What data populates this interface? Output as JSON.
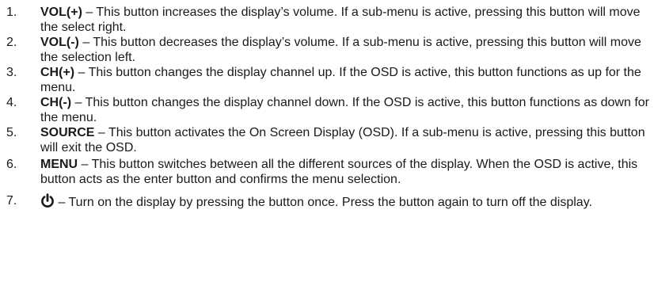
{
  "items": [
    {
      "number": "1.",
      "term": "VOL(+)",
      "text": " – This button increases the display’s volume.  If a sub-menu is active, pressing this button will move the select right."
    },
    {
      "number": "2.",
      "term": "VOL(-)",
      "text": " – This button decreases the display’s volume.  If a sub-menu is active, pressing this button will move the selection left."
    },
    {
      "number": "3.",
      "term": "CH(+)",
      "text": " – This button changes the display channel up.  If the OSD is active, this button functions as up for the menu."
    },
    {
      "number": "4.",
      "term": "CH(-)",
      "text": " – This button changes the display channel down.  If the OSD is active, this button functions as down for the menu."
    },
    {
      "number": "5.",
      "term": "SOURCE",
      "text": " – This button activates the On Screen Display (OSD).  If a sub-menu is active, pressing this button will exit the OSD."
    },
    {
      "number": "6.",
      "term": "MENU",
      "text": " – This button switches between all the different sources of the display. When the OSD is active, this button acts as the enter button and confirms the menu selection."
    },
    {
      "number": "7.",
      "icon": "power-icon",
      "text": " – Turn on the display by pressing the button once.  Press the button again to turn off the display."
    }
  ]
}
